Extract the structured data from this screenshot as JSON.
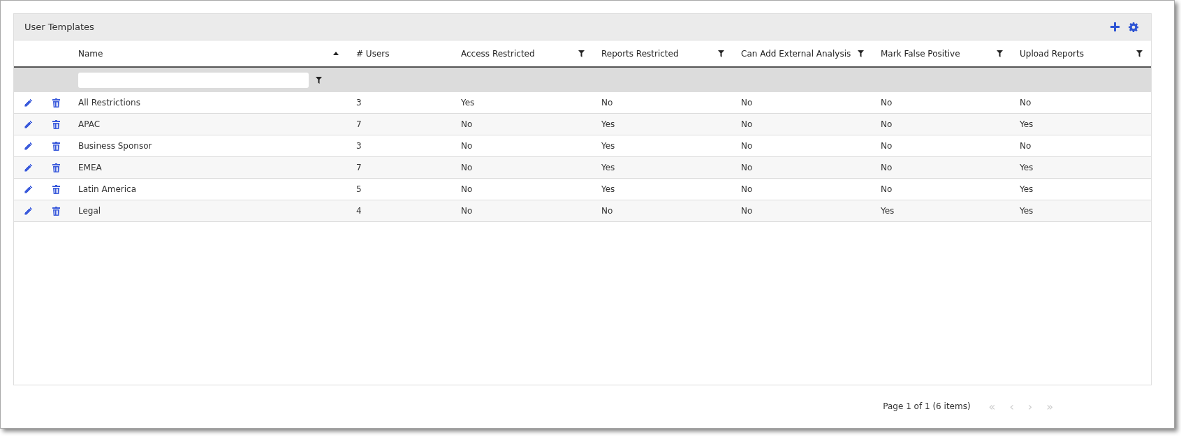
{
  "panel": {
    "title": "User Templates"
  },
  "table": {
    "columns": [
      {
        "label": "Name",
        "sorted_ascending": true,
        "filter": false
      },
      {
        "label": "# Users",
        "sorted_ascending": false,
        "filter": false
      },
      {
        "label": "Access Restricted",
        "sorted_ascending": false,
        "filter": true
      },
      {
        "label": "Reports Restricted",
        "sorted_ascending": false,
        "filter": true
      },
      {
        "label": "Can Add External Analysis",
        "sorted_ascending": false,
        "filter": true
      },
      {
        "label": "Mark False Positive",
        "sorted_ascending": false,
        "filter": true
      },
      {
        "label": "Upload Reports",
        "sorted_ascending": false,
        "filter": true
      }
    ],
    "rows": [
      {
        "cells": [
          "All Restrictions",
          "3",
          "Yes",
          "No",
          "No",
          "No",
          "No"
        ]
      },
      {
        "cells": [
          "APAC",
          "7",
          "No",
          "Yes",
          "No",
          "No",
          "Yes"
        ]
      },
      {
        "cells": [
          "Business Sponsor",
          "3",
          "No",
          "Yes",
          "No",
          "No",
          "No"
        ]
      },
      {
        "cells": [
          "EMEA",
          "7",
          "No",
          "Yes",
          "No",
          "No",
          "Yes"
        ]
      },
      {
        "cells": [
          "Latin America",
          "5",
          "No",
          "Yes",
          "No",
          "No",
          "Yes"
        ]
      },
      {
        "cells": [
          "Legal",
          "4",
          "No",
          "No",
          "No",
          "Yes",
          "Yes"
        ]
      }
    ]
  },
  "pager": {
    "summary": "Page 1 of 1 (6 items)",
    "buttons": [
      {
        "label": "«",
        "disabled": true
      },
      {
        "label": "‹",
        "disabled": true
      },
      {
        "label": "›",
        "disabled": true
      },
      {
        "label": "»",
        "disabled": true
      }
    ]
  }
}
